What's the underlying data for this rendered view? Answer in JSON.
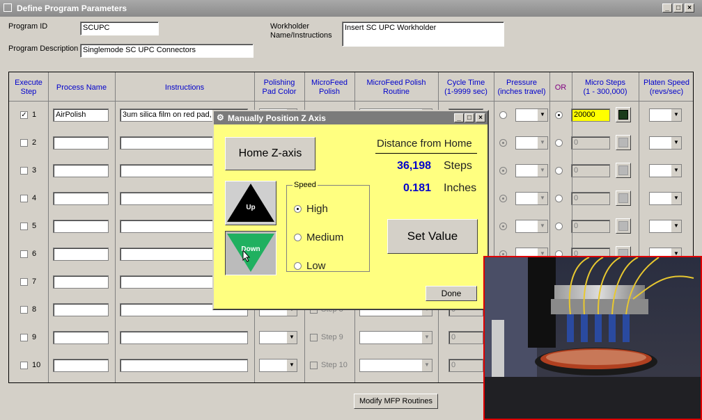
{
  "window": {
    "title": "Define Program Parameters"
  },
  "form": {
    "program_id_label": "Program ID",
    "program_id_value": "SCUPC",
    "program_desc_label": "Program Description",
    "program_desc_value": "Singlemode SC UPC Connectors",
    "workholder_label_1": "Workholder",
    "workholder_label_2": "Name/Instructions",
    "workholder_value": "Insert SC UPC Workholder"
  },
  "headers": {
    "execute_step": [
      "Execute",
      "Step"
    ],
    "process_name": [
      "Process Name"
    ],
    "instructions": [
      "Instructions"
    ],
    "pad_color": [
      "Polishing",
      "Pad Color"
    ],
    "mf_polish": [
      "MicroFeed",
      "Polish"
    ],
    "mf_routine": [
      "MicroFeed Polish",
      "Routine"
    ],
    "cycle_time": [
      "Cycle Time",
      "(1-9999 sec)"
    ],
    "pressure": [
      "Pressure",
      "(inches travel)"
    ],
    "or": [
      "OR"
    ],
    "micro_steps": [
      "Micro Steps",
      "(1 - 300,000)"
    ],
    "platen_speed": [
      "Platen Speed",
      "(revs/sec)"
    ]
  },
  "rows": [
    {
      "num": "1",
      "checked": true,
      "process": "AirPolish",
      "instructions": "3um silica film on red pad, c",
      "step_label": "",
      "cycle": "",
      "micro": "20000"
    },
    {
      "num": "2",
      "checked": false,
      "process": "",
      "instructions": "",
      "step_label": "",
      "cycle": "",
      "micro": "0"
    },
    {
      "num": "3",
      "checked": false,
      "process": "",
      "instructions": "",
      "step_label": "",
      "cycle": "",
      "micro": "0"
    },
    {
      "num": "4",
      "checked": false,
      "process": "",
      "instructions": "",
      "step_label": "",
      "cycle": "",
      "micro": "0"
    },
    {
      "num": "5",
      "checked": false,
      "process": "",
      "instructions": "",
      "step_label": "",
      "cycle": "",
      "micro": "0"
    },
    {
      "num": "6",
      "checked": false,
      "process": "",
      "instructions": "",
      "step_label": "",
      "cycle": "",
      "micro": "0"
    },
    {
      "num": "7",
      "checked": false,
      "process": "",
      "instructions": "",
      "step_label": "",
      "cycle": "",
      "micro": ""
    },
    {
      "num": "8",
      "checked": false,
      "process": "",
      "instructions": "",
      "step_label": "Step 8",
      "cycle": "0",
      "micro": ""
    },
    {
      "num": "9",
      "checked": false,
      "process": "",
      "instructions": "",
      "step_label": "Step 9",
      "cycle": "0",
      "micro": ""
    },
    {
      "num": "10",
      "checked": false,
      "process": "",
      "instructions": "",
      "step_label": "Step 10",
      "cycle": "0",
      "micro": ""
    }
  ],
  "modify_button": "Modify MFP Routines",
  "dialog": {
    "title": "Manually Position Z Axis",
    "home_button": "Home Z-axis",
    "distance_heading": "Distance from Home",
    "steps_value": "36,198",
    "steps_unit": "Steps",
    "inches_value": "0.181",
    "inches_unit": "Inches",
    "up_label": "Up",
    "down_label": "Down",
    "speed_label": "Speed",
    "speed_options": [
      "High",
      "Medium",
      "Low"
    ],
    "speed_selected": "High",
    "set_value_button": "Set Value",
    "done_button": "Done"
  },
  "colors": {
    "header_text": "#0000cc",
    "dialog_bg": "#ffff80",
    "value_blue": "#0000cc",
    "highlight_yellow": "#ffff00",
    "photo_border": "#e00000",
    "down_green": "#20b060"
  }
}
